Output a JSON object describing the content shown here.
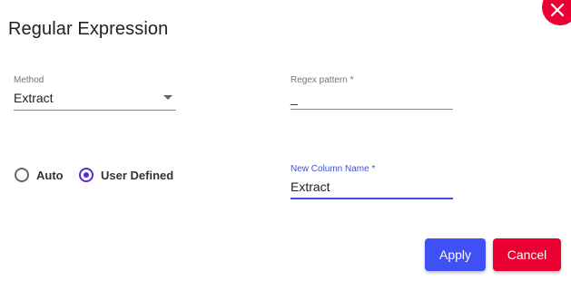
{
  "dialog": {
    "title": "Regular Expression"
  },
  "method": {
    "label": "Method",
    "value": "Extract"
  },
  "regex": {
    "label": "Regex pattern *",
    "value": "_"
  },
  "mode": {
    "options": [
      {
        "label": "Auto",
        "checked": false
      },
      {
        "label": "User Defined",
        "checked": true
      }
    ]
  },
  "new_column": {
    "label": "New Column Name *",
    "value": "Extract"
  },
  "actions": {
    "apply_label": "Apply",
    "cancel_label": "Cancel"
  },
  "colors": {
    "primary": "#3f51f5",
    "danger": "#ea0033",
    "radio_accent": "#5b2bd6",
    "focus_underline": "#3f51d6"
  },
  "icons": {
    "close": "close-icon",
    "dropdown": "chevron-down-icon"
  }
}
